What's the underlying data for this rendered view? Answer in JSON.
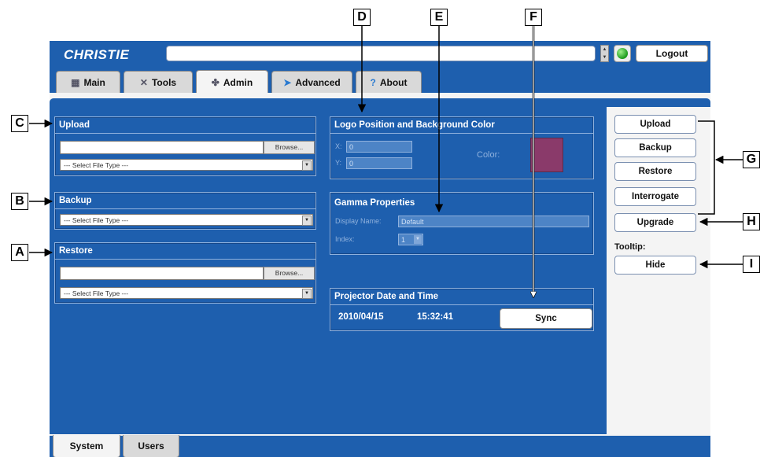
{
  "app": {
    "brand": "CHRISTIE",
    "url_value": "",
    "logout_label": "Logout"
  },
  "tabs": [
    {
      "label": "Main",
      "icon": "main-icon"
    },
    {
      "label": "Tools",
      "icon": "tools-icon"
    },
    {
      "label": "Admin",
      "icon": "admin-icon",
      "active": true
    },
    {
      "label": "Advanced",
      "icon": "advanced-icon"
    },
    {
      "label": "About",
      "icon": "about-icon"
    }
  ],
  "upload": {
    "title": "Upload",
    "browse_label": "Browse...",
    "select_value": "--- Select File Type ---"
  },
  "backup": {
    "title": "Backup",
    "select_value": "--- Select File Type ---"
  },
  "restore": {
    "title": "Restore",
    "browse_label": "Browse...",
    "select_value": "--- Select File Type ---"
  },
  "logo": {
    "title": "Logo Position and Background Color",
    "x_label": "X:",
    "x_value": "0",
    "y_label": "Y:",
    "y_value": "0",
    "color_label": "Color:",
    "color_value": "#8a3a6a"
  },
  "gamma": {
    "title": "Gamma Properties",
    "display_name_label": "Display Name:",
    "display_name_value": "Default",
    "index_label": "Index:",
    "index_value": "1"
  },
  "datetime": {
    "title": "Projector Date and Time",
    "date": "2010/04/15",
    "time": "15:32:41",
    "sync_label": "Sync"
  },
  "actions": {
    "upload": "Upload",
    "backup": "Backup",
    "restore": "Restore",
    "interrogate": "Interrogate",
    "upgrade": "Upgrade",
    "tooltip_label": "Tooltip:",
    "hide": "Hide"
  },
  "bottom_tabs": [
    {
      "label": "System",
      "active": true
    },
    {
      "label": "Users"
    }
  ],
  "callouts": {
    "a": "A",
    "b": "B",
    "c": "C",
    "d": "D",
    "e": "E",
    "f": "F",
    "g": "G",
    "h": "H",
    "i": "I"
  },
  "colors": {
    "app_blue": "#1e5fae",
    "panel_border": "#8fb1dd",
    "swatch": "#8a3a6a"
  }
}
